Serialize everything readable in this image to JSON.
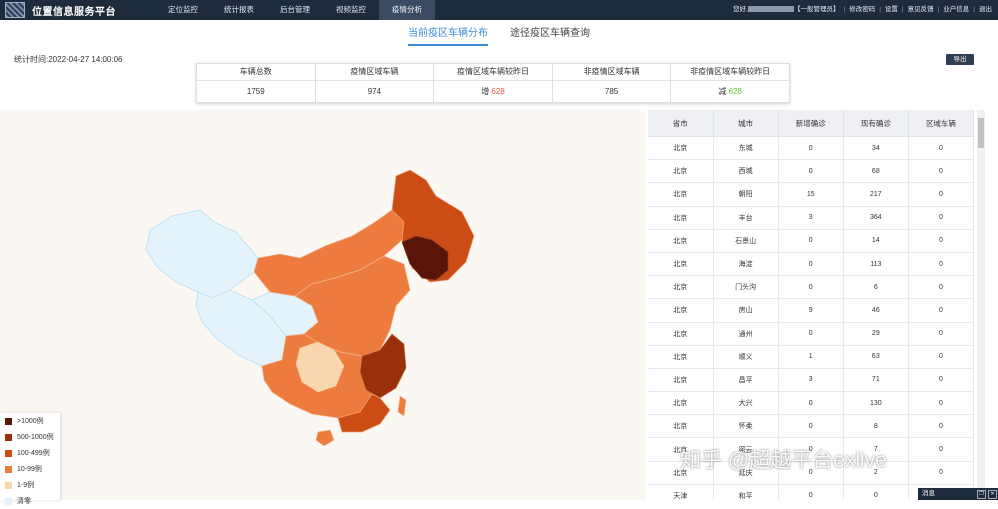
{
  "app": {
    "title": "位置信息服务平台",
    "logo_icon": "grid-logo-icon"
  },
  "nav": {
    "items": [
      "定位监控",
      "统计报表",
      "后台管理",
      "视频监控",
      "疫情分析"
    ],
    "active_index": 4
  },
  "user": {
    "greeting": "您好,",
    "role": "【一般管理员】",
    "links": [
      "修改密码",
      "设置",
      "意见反馈",
      "业户信息",
      "退出"
    ]
  },
  "subtabs": [
    "当前疫区车辆分布",
    "途径疫区车辆查询"
  ],
  "stat_time": "统计时间:2022-04-27 14:00:06",
  "export_label": "导出",
  "stats": [
    {
      "label": "车辆总数",
      "value": "1759"
    },
    {
      "label": "疫情区域车辆",
      "value": "974"
    },
    {
      "label": "疫情区域车辆较昨日",
      "prefix": "增",
      "value": "628",
      "tone": "#e55a4b"
    },
    {
      "label": "非疫情区域车辆",
      "value": "785"
    },
    {
      "label": "非疫情区域车辆较昨日",
      "prefix": "减",
      "value": "628",
      "tone": "#67c23a"
    }
  ],
  "legend": [
    {
      "label": ">1000例",
      "color": "#5a1408"
    },
    {
      "label": "500-1000例",
      "color": "#9a2f0c"
    },
    {
      "label": "100-499例",
      "color": "#cc4c16"
    },
    {
      "label": "10-99例",
      "color": "#ee7b3e"
    },
    {
      "label": "1-9例",
      "color": "#f9d6b0"
    },
    {
      "label": "清零",
      "color": "#e4f3fb"
    }
  ],
  "table": {
    "headers": [
      "省市",
      "城市",
      "新增确诊",
      "现有确诊",
      "区域车辆"
    ],
    "rows": [
      [
        "北京",
        "东城",
        "0",
        "34",
        "0"
      ],
      [
        "北京",
        "西城",
        "0",
        "68",
        "0"
      ],
      [
        "北京",
        "朝阳",
        "15",
        "217",
        "0"
      ],
      [
        "北京",
        "丰台",
        "3",
        "364",
        "0"
      ],
      [
        "北京",
        "石景山",
        "0",
        "14",
        "0"
      ],
      [
        "北京",
        "海淀",
        "0",
        "113",
        "0"
      ],
      [
        "北京",
        "门头沟",
        "0",
        "6",
        "0"
      ],
      [
        "北京",
        "房山",
        "9",
        "46",
        "0"
      ],
      [
        "北京",
        "通州",
        "0",
        "29",
        "0"
      ],
      [
        "北京",
        "顺义",
        "1",
        "63",
        "0"
      ],
      [
        "北京",
        "昌平",
        "3",
        "71",
        "0"
      ],
      [
        "北京",
        "大兴",
        "0",
        "130",
        "0"
      ],
      [
        "北京",
        "怀柔",
        "0",
        "8",
        "0"
      ],
      [
        "北京",
        "密云",
        "0",
        "7",
        "0"
      ],
      [
        "北京",
        "延庆",
        "0",
        "2",
        "0"
      ],
      [
        "天津",
        "和平",
        "0",
        "0",
        "0"
      ]
    ]
  },
  "message_bar": {
    "label": "消息"
  },
  "watermark": "知乎 @超越平台exlive"
}
